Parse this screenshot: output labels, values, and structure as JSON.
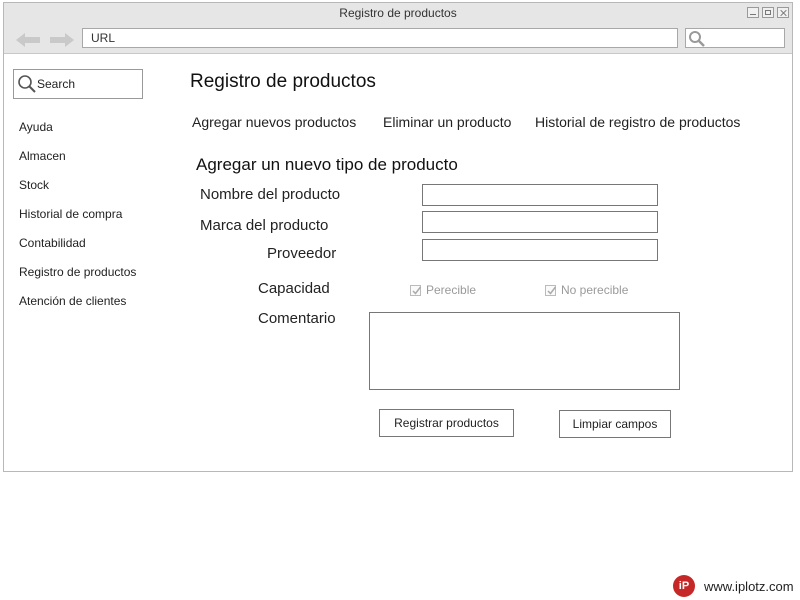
{
  "window": {
    "title": "Registro de productos"
  },
  "toolbar": {
    "url_text": "URL"
  },
  "sidebar": {
    "search_label": "Search",
    "items": [
      "Ayuda",
      "Almacen",
      "Stock",
      "Historial de compra",
      "Contabilidad",
      "Registro de productos",
      "Atención de clientes"
    ]
  },
  "main": {
    "title": "Registro de productos",
    "tabs": [
      "Agregar nuevos productos",
      "Eliminar un producto",
      "Historial de registro de productos"
    ],
    "form": {
      "heading": "Agregar un nuevo tipo de producto",
      "name_label": "Nombre del producto",
      "name_value": "",
      "brand_label": "Marca del producto",
      "brand_value": "",
      "supplier_label": "Proveedor",
      "supplier_value": "",
      "capacity_label": "Capacidad",
      "options": [
        {
          "label": "Perecible",
          "checked": true
        },
        {
          "label": "No perecible",
          "checked": true
        }
      ],
      "comment_label": "Comentario",
      "comment_value": "",
      "submit_label": "Registrar productos",
      "clear_label": "Limpiar campos"
    }
  },
  "footer": {
    "logo_text": "iP",
    "site": "www.iplotz.com"
  },
  "colors": {
    "logo_red": "#c62828",
    "chrome_gray": "#e6e6e6",
    "disabled_text": "#9a9a9a"
  }
}
